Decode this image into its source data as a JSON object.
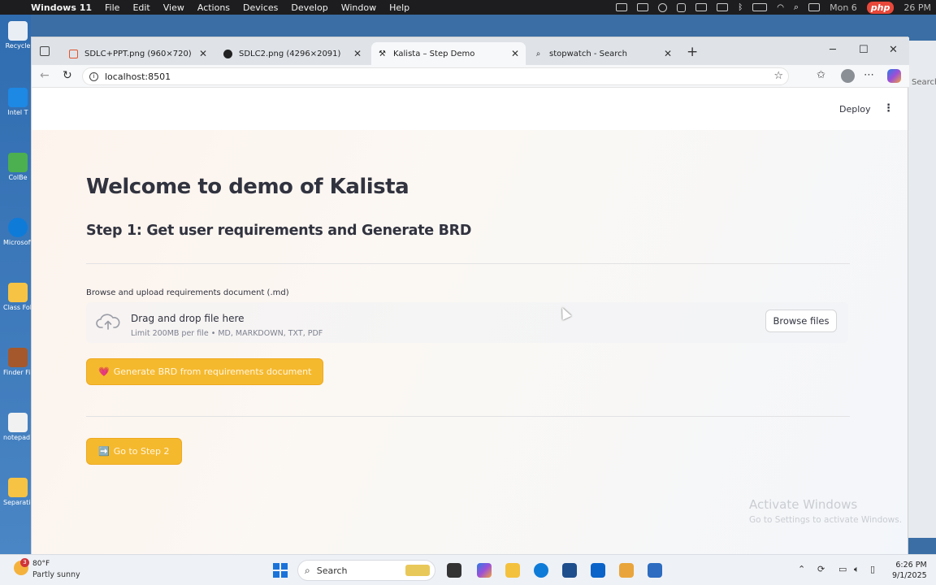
{
  "macbar": {
    "apple": "",
    "app_name": "Windows 11",
    "menus": [
      "File",
      "Edit",
      "View",
      "Actions",
      "Devices",
      "Develop",
      "Window",
      "Help"
    ],
    "right_badge": "php",
    "right_text": "Mon 6",
    "clock": "26 PM"
  },
  "desktop": {
    "icons": [
      "Recycle",
      "Intel T",
      "ColBe",
      "Microsoft Edge",
      "Class Folder",
      "Finder File",
      "notepad desktop",
      "Separation"
    ]
  },
  "right_strip": {
    "search_text": "Search"
  },
  "browser": {
    "tabs": [
      {
        "title": "SDLC+PPT.png (960×720)",
        "favicon": "image-icon",
        "active": false
      },
      {
        "title": "SDLC2.png (4296×2091)",
        "favicon": "github-icon",
        "active": false
      },
      {
        "title": "Kalista – Step Demo",
        "favicon": "tools-icon",
        "active": true
      },
      {
        "title": "stopwatch - Search",
        "favicon": "search-icon",
        "active": false
      }
    ],
    "new_tab": "+",
    "window_controls": {
      "minimize": "─",
      "maximize": "☐",
      "close": "✕"
    },
    "url": "localhost:8501"
  },
  "page": {
    "deploy_label": "Deploy",
    "menu_icon": "⋮",
    "title": "Welcome to demo of Kalista",
    "step_heading": "Step 1: Get user requirements and Generate BRD",
    "upload_label": "Browse and upload requirements document (.md)",
    "dropzone": {
      "title": "Drag and drop file here",
      "subtitle": "Limit 200MB per file • MD, MARKDOWN, TXT, PDF",
      "browse_label": "Browse files"
    },
    "generate_button": {
      "emoji": "💗",
      "label": "Generate BRD from requirements document"
    },
    "next_button": {
      "emoji": "➡️",
      "label": "Go to Step 2"
    },
    "watermark": {
      "line1": "Activate Windows",
      "line2": "Go to Settings to activate Windows."
    }
  },
  "taskbar": {
    "weather_badge": "3",
    "temperature": "80°F",
    "condition": "Partly sunny",
    "search_label": "Search",
    "time": "6:26 PM",
    "date": "9/1/2025"
  },
  "colors": {
    "accent_button": "#f5b92e",
    "text_primary": "#31333f",
    "page_tint": "#fdf3ec"
  }
}
